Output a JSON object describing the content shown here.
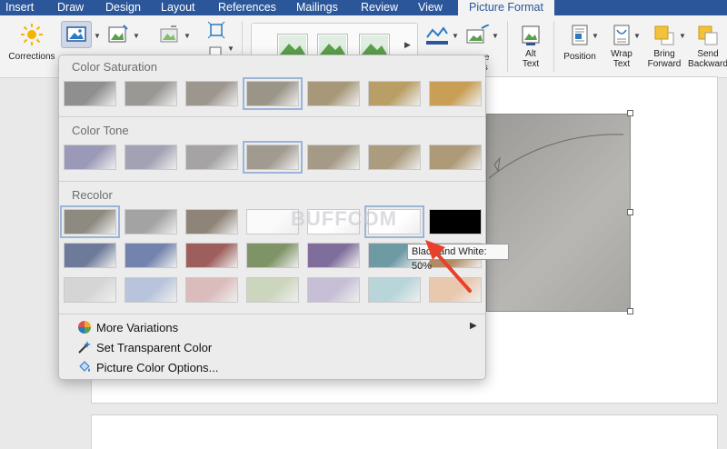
{
  "tabs": [
    {
      "label": "Insert"
    },
    {
      "label": "Draw"
    },
    {
      "label": "Design"
    },
    {
      "label": "Layout"
    },
    {
      "label": "References"
    },
    {
      "label": "Mailings"
    },
    {
      "label": "Review"
    },
    {
      "label": "View"
    },
    {
      "label": "Picture Format",
      "active": true
    }
  ],
  "ribbon": {
    "corrections": "Corrections",
    "alt_text_1": "Alt",
    "alt_text_2": "Text",
    "position": "Position",
    "wrap_text_1": "Wrap",
    "wrap_text_2": "Text",
    "bring_forward_1": "Bring",
    "bring_forward_2": "Forward",
    "send_backward_1": "Send",
    "send_backward_2": "Backward",
    "partial_label_1": "ure",
    "partial_label_2": "cts"
  },
  "panel": {
    "color_saturation": "Color Saturation",
    "color_tone": "Color Tone",
    "recolor": "Recolor",
    "saturation_colors": [
      "#8f8f8f",
      "#9a9894",
      "#9c968e",
      "#9b9588",
      "#a8987a",
      "#b99f66",
      "#c99f55"
    ],
    "tone_colors": [
      "#9a9ab8",
      "#a2a2b4",
      "#a5a3a3",
      "#a19a8e",
      "#a49a86",
      "#ab9c80",
      "#af9a78"
    ],
    "recolor_row1": [
      "#8e8a80",
      "#a3a3a3",
      "#8e8478",
      "#fafafa",
      "#ffffff",
      "#ffffff",
      "#000000"
    ],
    "recolor_row2": [
      "#6e7a99",
      "#7283ad",
      "#9e5f5c",
      "#7f9466",
      "#7f6e9b",
      "#6e9aa4",
      "#b18a62"
    ],
    "recolor_row3": [
      "#d5d5d5",
      "#b8c4db",
      "#dbbcbc",
      "#ccd5bd",
      "#c7bfd6",
      "#b8d5da",
      "#e9c9ae"
    ],
    "more_variations": "More Variations",
    "set_transparent_color": "Set Transparent Color",
    "picture_color_options": "Picture Color Options..."
  },
  "tooltip": "Black and White: 50%",
  "watermark": "BUFFCOM"
}
